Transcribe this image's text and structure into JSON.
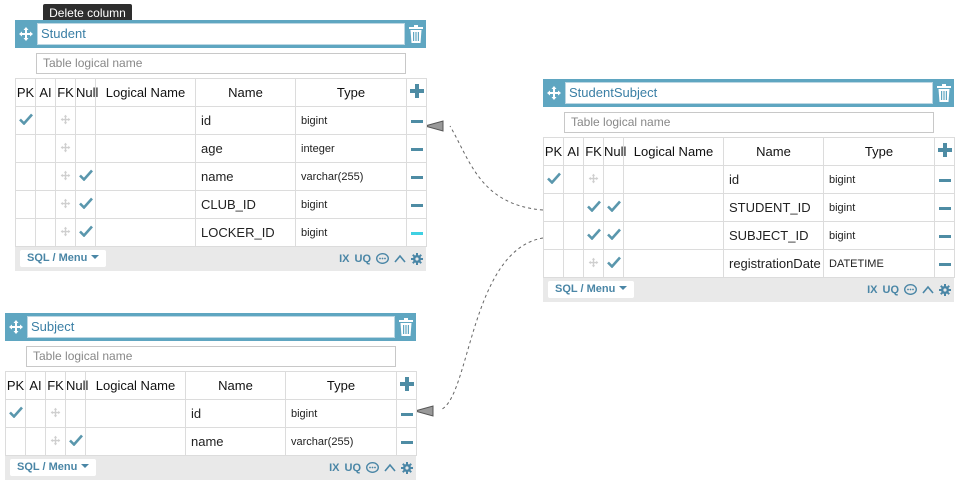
{
  "tooltip": "Delete column",
  "columns_header": {
    "pk": "PK",
    "ai": "AI",
    "fk": "FK",
    "null": "Null",
    "logical": "Logical Name",
    "name": "Name",
    "type": "Type"
  },
  "logical_placeholder": "Table logical name",
  "sql_menu_label": "SQL / Menu",
  "footer_labels": {
    "index": "IX",
    "unique": "UQ"
  },
  "tables": {
    "student": {
      "name": "Student",
      "rows": [
        {
          "pk": true,
          "fk": false,
          "null": false,
          "name": "id",
          "type": "bigint"
        },
        {
          "pk": false,
          "fk": false,
          "null": false,
          "name": "age",
          "type": "integer"
        },
        {
          "pk": false,
          "fk": false,
          "null": true,
          "name": "name",
          "type": "varchar(255)"
        },
        {
          "pk": false,
          "fk": false,
          "null": true,
          "name": "CLUB_ID",
          "type": "bigint"
        },
        {
          "pk": false,
          "fk": false,
          "null": true,
          "name": "LOCKER_ID",
          "type": "bigint"
        }
      ]
    },
    "student_subject": {
      "name": "StudentSubject",
      "rows": [
        {
          "pk": true,
          "fk": false,
          "null": false,
          "name": "id",
          "type": "bigint"
        },
        {
          "pk": false,
          "fk": true,
          "null": true,
          "name": "STUDENT_ID",
          "type": "bigint"
        },
        {
          "pk": false,
          "fk": true,
          "null": true,
          "name": "SUBJECT_ID",
          "type": "bigint"
        },
        {
          "pk": false,
          "fk": false,
          "null": true,
          "name": "registrationDate",
          "type": "DATETIME"
        }
      ]
    },
    "subject": {
      "name": "Subject",
      "rows": [
        {
          "pk": true,
          "fk": false,
          "null": false,
          "name": "id",
          "type": "bigint"
        },
        {
          "pk": false,
          "fk": false,
          "null": true,
          "name": "name",
          "type": "varchar(255)"
        }
      ]
    }
  },
  "colors": {
    "header": "#5fa6c1",
    "check": "#5a97ad",
    "icon": "#4e8ca4",
    "highlight_minus": "#3fd0e2"
  }
}
